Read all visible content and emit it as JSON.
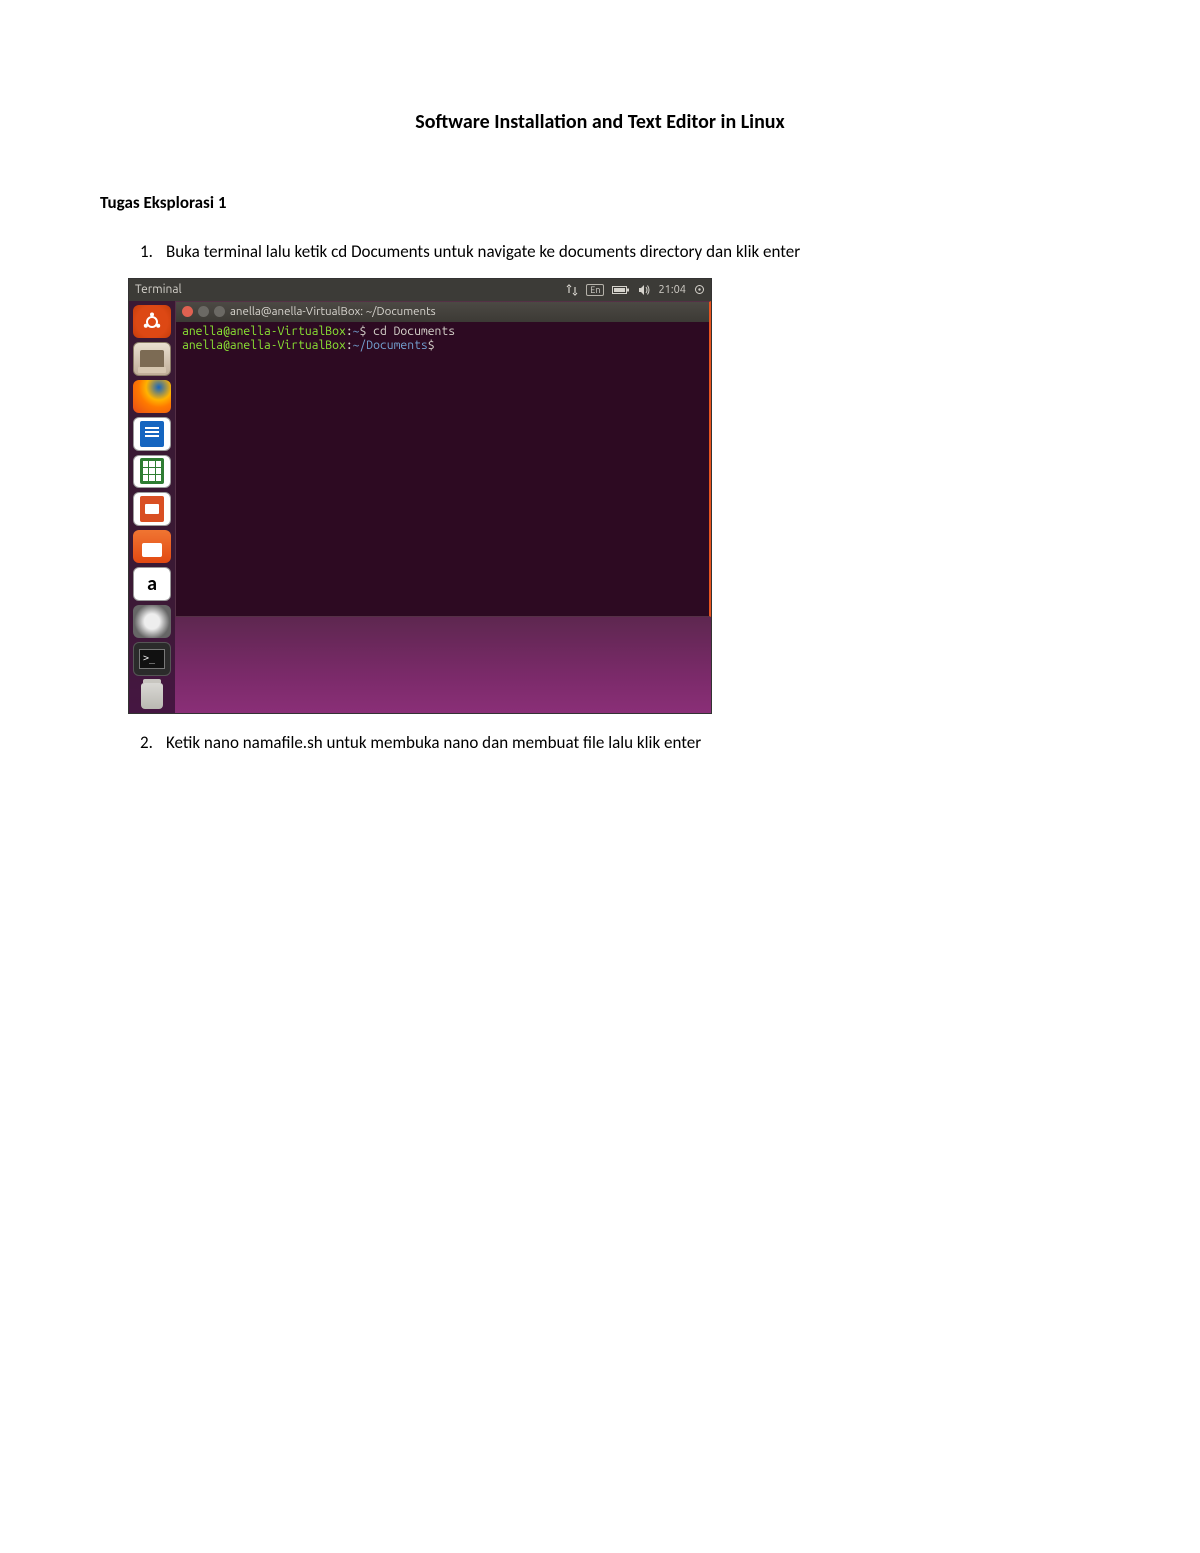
{
  "doc": {
    "title": "Software Installation and Text Editor in Linux",
    "section_heading": "Tugas Eksplorasi 1",
    "steps": [
      {
        "num": "1.",
        "text": "Buka terminal lalu ketik cd Documents untuk navigate ke documents directory dan klik enter"
      },
      {
        "num": "2.",
        "text": "Ketik nano namafile.sh untuk membuka nano dan membuat file lalu klik enter"
      }
    ]
  },
  "screenshot": {
    "menubar_title": "Terminal",
    "indicators": {
      "lang": "En",
      "time": "21:04"
    },
    "launcher": [
      "ubuntu-dash",
      "files",
      "firefox",
      "libreoffice-writer",
      "libreoffice-calc",
      "libreoffice-impress",
      "ubuntu-software",
      "amazon",
      "disc",
      "terminal",
      "trash"
    ],
    "terminal": {
      "title": "anella@anella-VirtualBox: ~/Documents",
      "lines": [
        {
          "user": "anella@anella-VirtualBox",
          "path": "~",
          "dollar": "$",
          "cmd": " cd Documents"
        },
        {
          "user": "anella@anella-VirtualBox",
          "path": "~/Documents",
          "dollar": "$",
          "cmd": ""
        }
      ]
    }
  }
}
